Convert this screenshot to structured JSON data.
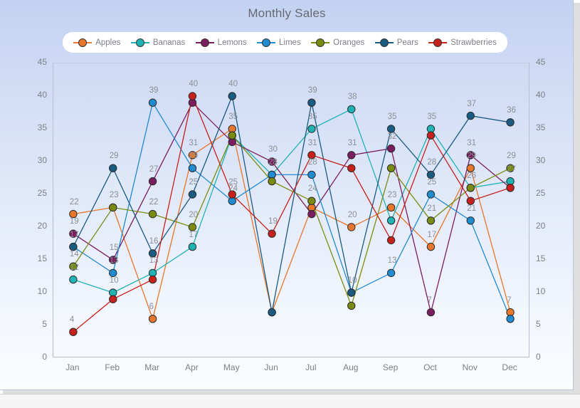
{
  "chart_data": {
    "type": "line",
    "title": "Monthly Sales",
    "xlabel": "",
    "ylabel": "",
    "ylim": [
      0,
      45
    ],
    "yticks": [
      0,
      5,
      10,
      15,
      20,
      25,
      30,
      35,
      40,
      45
    ],
    "grid": false,
    "legend_position": "top",
    "show_point_labels": true,
    "categories": [
      "Jan",
      "Feb",
      "Mar",
      "Apr",
      "May",
      "Jun",
      "Jul",
      "Aug",
      "Sep",
      "Oct",
      "Nov",
      "Dec"
    ],
    "series": [
      {
        "name": "Apples",
        "color": "#e8762c",
        "values": [
          22,
          23,
          6,
          31,
          35,
          7,
          23,
          20,
          23,
          17,
          29,
          7
        ]
      },
      {
        "name": "Bananas",
        "color": "#1fb3b3",
        "values": [
          12,
          10,
          13,
          17,
          34,
          28,
          35,
          38,
          21,
          35,
          26,
          27
        ]
      },
      {
        "name": "Lemons",
        "color": "#7b1d5e",
        "values": [
          19,
          15,
          27,
          39,
          33,
          30,
          22,
          31,
          32,
          7,
          31,
          26
        ]
      },
      {
        "name": "Limes",
        "color": "#1f8bd1",
        "values": [
          17,
          13,
          39,
          29,
          24,
          28,
          28,
          10,
          13,
          25,
          21,
          6
        ]
      },
      {
        "name": "Oranges",
        "color": "#7a8c10",
        "values": [
          14,
          23,
          22,
          20,
          34,
          27,
          24,
          8,
          29,
          21,
          26,
          29
        ]
      },
      {
        "name": "Pears",
        "color": "#1a5b82",
        "values": [
          17,
          29,
          16,
          25,
          40,
          7,
          39,
          10,
          35,
          28,
          37,
          36
        ]
      },
      {
        "name": "Strawberries",
        "color": "#c8201a",
        "values": [
          4,
          9,
          12,
          40,
          25,
          19,
          31,
          29,
          18,
          34,
          24,
          26
        ]
      }
    ],
    "point_labels": [
      {
        "series": "Apples",
        "month": "Jan",
        "text": "22"
      },
      {
        "series": "Lemons",
        "month": "Jan",
        "text": "19"
      },
      {
        "series": "Limes",
        "month": "Jan",
        "text": "17"
      },
      {
        "series": "Oranges",
        "month": "Jan",
        "text": "14"
      },
      {
        "series": "Bananas",
        "month": "Jan",
        "text": "12"
      },
      {
        "series": "Strawberries",
        "month": "Jan",
        "text": "4"
      },
      {
        "series": "Pears",
        "month": "Feb",
        "text": "29"
      },
      {
        "series": "Apples",
        "month": "Feb",
        "text": "23"
      },
      {
        "series": "Lemons",
        "month": "Feb",
        "text": "15"
      },
      {
        "series": "Limes",
        "month": "Feb",
        "text": "13"
      },
      {
        "series": "Bananas",
        "month": "Feb",
        "text": "10"
      },
      {
        "series": "Limes",
        "month": "Mar",
        "text": "39"
      },
      {
        "series": "Lemons",
        "month": "Mar",
        "text": "27"
      },
      {
        "series": "Oranges",
        "month": "Mar",
        "text": "22"
      },
      {
        "series": "Pears",
        "month": "Mar",
        "text": "16"
      },
      {
        "series": "Bananas",
        "month": "Mar",
        "text": "13"
      },
      {
        "series": "Apples",
        "month": "Mar",
        "text": "6"
      },
      {
        "series": "Strawberries",
        "month": "Apr",
        "text": "40"
      },
      {
        "series": "Apples",
        "month": "Apr",
        "text": "31"
      },
      {
        "series": "Limes",
        "month": "Apr",
        "text": "29"
      },
      {
        "series": "Pears",
        "month": "Apr",
        "text": "25"
      },
      {
        "series": "Oranges",
        "month": "Apr",
        "text": "20"
      },
      {
        "series": "Bananas",
        "month": "Apr",
        "text": "17"
      },
      {
        "series": "Pears",
        "month": "May",
        "text": "40"
      },
      {
        "series": "Apples",
        "month": "May",
        "text": "35"
      },
      {
        "series": "Strawberries",
        "month": "May",
        "text": "25"
      },
      {
        "series": "Limes",
        "month": "May",
        "text": "24"
      },
      {
        "series": "Lemons",
        "month": "Jun",
        "text": "30"
      },
      {
        "series": "Bananas",
        "month": "Jun",
        "text": "28"
      },
      {
        "series": "Strawberries",
        "month": "Jun",
        "text": "19"
      },
      {
        "series": "Pears",
        "month": "Jul",
        "text": "39"
      },
      {
        "series": "Bananas",
        "month": "Jul",
        "text": "35"
      },
      {
        "series": "Strawberries",
        "month": "Jul",
        "text": "31"
      },
      {
        "series": "Limes",
        "month": "Jul",
        "text": "28"
      },
      {
        "series": "Oranges",
        "month": "Jul",
        "text": "24"
      },
      {
        "series": "Bananas",
        "month": "Aug",
        "text": "38"
      },
      {
        "series": "Lemons",
        "month": "Aug",
        "text": "31"
      },
      {
        "series": "Apples",
        "month": "Aug",
        "text": "20"
      },
      {
        "series": "Pears",
        "month": "Aug",
        "text": "10"
      },
      {
        "series": "Pears",
        "month": "Sep",
        "text": "35"
      },
      {
        "series": "Lemons",
        "month": "Sep",
        "text": "32"
      },
      {
        "series": "Apples",
        "month": "Sep",
        "text": "23"
      },
      {
        "series": "Limes",
        "month": "Sep",
        "text": "13"
      },
      {
        "series": "Bananas",
        "month": "Oct",
        "text": "35"
      },
      {
        "series": "Pears",
        "month": "Oct",
        "text": "28"
      },
      {
        "series": "Limes",
        "month": "Oct",
        "text": "25"
      },
      {
        "series": "Oranges",
        "month": "Oct",
        "text": "21"
      },
      {
        "series": "Apples",
        "month": "Oct",
        "text": "17"
      },
      {
        "series": "Lemons",
        "month": "Oct",
        "text": "7"
      },
      {
        "series": "Pears",
        "month": "Nov",
        "text": "37"
      },
      {
        "series": "Lemons",
        "month": "Nov",
        "text": "31"
      },
      {
        "series": "Apples",
        "month": "Nov",
        "text": "29"
      },
      {
        "series": "Bananas",
        "month": "Nov",
        "text": "26"
      },
      {
        "series": "Limes",
        "month": "Nov",
        "text": "21"
      },
      {
        "series": "Pears",
        "month": "Dec",
        "text": "36"
      },
      {
        "series": "Oranges",
        "month": "Dec",
        "text": "29"
      },
      {
        "series": "Bananas",
        "month": "Dec",
        "text": "27"
      },
      {
        "series": "Apples",
        "month": "Dec",
        "text": "7"
      }
    ]
  },
  "theme": {
    "panel_gradient_top": "#c3d2f2",
    "panel_gradient_bottom": "#fbfcfe",
    "title_color": "#666a70",
    "tick_color": "#7c8086",
    "axis_color": "#b6bfd2",
    "legend_bg": "#ffffff",
    "label_color": "#8b8f95"
  }
}
